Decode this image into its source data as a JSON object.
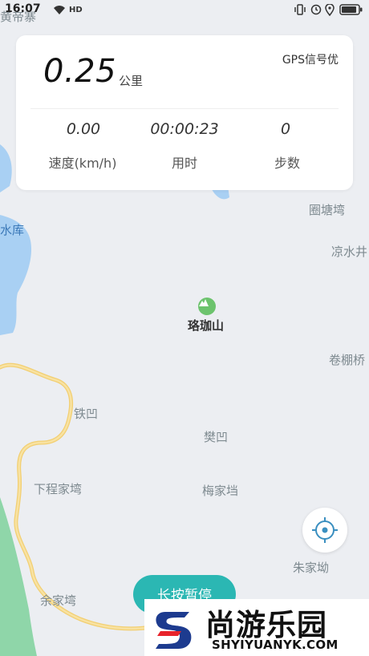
{
  "status_bar": {
    "time": "16:07",
    "network_label": "HD"
  },
  "map": {
    "labels": {
      "top_left": "黄帝寨",
      "reservoir": "水库",
      "quantangwan": "圈塘塆",
      "liangshuijing": "凉水井",
      "luojiashan": "珞珈山",
      "juanpengqiao": "卷棚桥",
      "tiewa": "铁凹",
      "fanwa": "樊凹",
      "xiachengjiawan": "下程家塆",
      "meijiadang": "梅家垱",
      "zhujiaao": "朱家坳",
      "yujiawan": "余家塆"
    }
  },
  "stats": {
    "distance": "0.25",
    "distance_unit": "公里",
    "gps": "GPS信号优",
    "speed_value": "0.00",
    "speed_label": "速度(km/h)",
    "time_value": "00:00:23",
    "time_label": "用时",
    "steps_value": "0",
    "steps_label": "步数"
  },
  "controls": {
    "pause_label": "长按暂停"
  },
  "watermark": {
    "title": "尚游乐园",
    "url": "SHYIYUANYK.COM"
  },
  "colors": {
    "accent": "#2bb7b3",
    "route": "#f5d57a",
    "water": "#a9d0f3",
    "park": "#8fd6a9"
  }
}
